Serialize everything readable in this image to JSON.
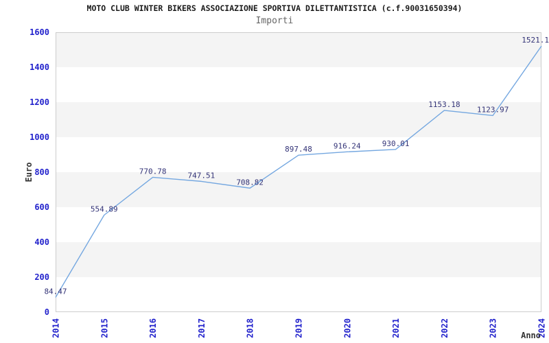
{
  "chart_data": {
    "type": "line",
    "title": "MOTO CLUB WINTER BIKERS ASSOCIAZIONE SPORTIVA DILETTANTISTICA (c.f.90031650394)",
    "subtitle": "Importi",
    "xlabel": "Anno",
    "ylabel": "Euro",
    "categories": [
      "2014",
      "2015",
      "2016",
      "2017",
      "2018",
      "2019",
      "2020",
      "2021",
      "2022",
      "2023",
      "2024"
    ],
    "series": [
      {
        "name": "Importi",
        "values": [
          84.47,
          554.89,
          770.78,
          747.51,
          708.82,
          897.48,
          916.24,
          930.01,
          1153.18,
          1123.97,
          1521.1
        ]
      }
    ],
    "point_labels": [
      "84.47",
      "554.89",
      "770.78",
      "747.51",
      "708.82",
      "897.48",
      "916.24",
      "930.01",
      "1153.18",
      "1123.97",
      "1521.1"
    ],
    "ylim": [
      0,
      1600
    ],
    "ytick_step": 200,
    "yticks": [
      0,
      200,
      400,
      600,
      800,
      1000,
      1200,
      1400,
      1600
    ],
    "legend": "none",
    "grid": "alternating horizontal bands",
    "x_tick_rotation": -90,
    "colors": {
      "line": "#74a7e0",
      "tick_labels": "#2222cc",
      "point_labels": "#333377",
      "band": "#f4f4f4",
      "plot_border": "#cccccc",
      "title": "#1a1a1a",
      "subtitle": "#666666",
      "axis_titles": "#333333",
      "background": "#ffffff"
    }
  }
}
